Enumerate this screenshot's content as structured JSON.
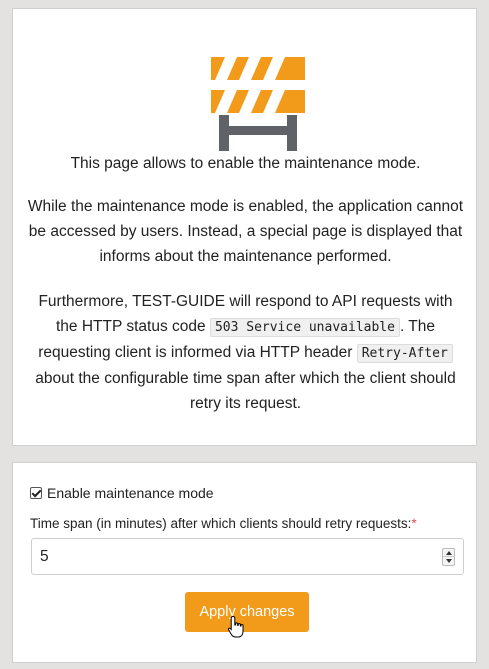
{
  "info": {
    "intro": "This page allows to enable the maintenance mode.",
    "description": "While the maintenance mode is enabled, the application cannot be accessed by users. Instead, a special page is displayed that informs about the maintenance performed.",
    "api_text_1": "Furthermore, TEST-GUIDE will respond to API requests with the HTTP status code ",
    "api_code_1": "503 Service unavailable",
    "api_text_2": ". The requesting client is informed via HTTP header ",
    "api_code_2": "Retry-After",
    "api_text_3": " about the configurable time span after which the client should retry its request.",
    "icon": "road-barrier-icon"
  },
  "form": {
    "checkbox_label": "Enable maintenance mode",
    "checkbox_checked": true,
    "field_label": "Time span (in minutes) after which clients should retry requests:",
    "required_marker": "*",
    "retry_minutes": "5",
    "apply_label": "Apply changes"
  },
  "colors": {
    "accent": "#f29b1a",
    "barrier_stripe": "#f29b1a",
    "barrier_frame": "#5f6266",
    "required": "#d9534f"
  }
}
